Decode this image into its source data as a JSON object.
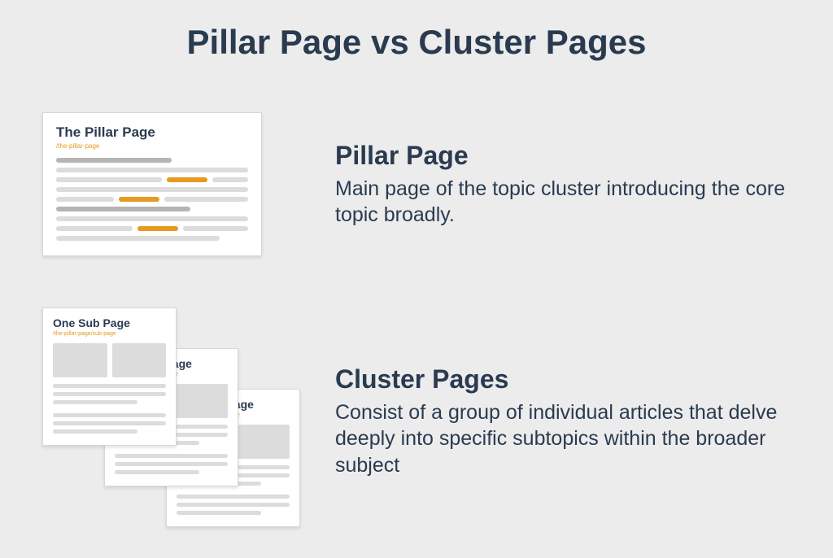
{
  "title": "Pillar Page vs Cluster Pages",
  "pillar": {
    "heading": "Pillar Page",
    "body": "Main page of the topic cluster introducing the core topic broadly.",
    "card_title": "The Pillar Page",
    "card_url": "/the-pillar-page"
  },
  "cluster": {
    "heading": "Cluster Pages",
    "body": "Consist of a group of individual articles that delve deeply into specific subtopics within the broader subject",
    "cards": [
      {
        "title": "One Sub Page",
        "url": "/the-pillar-page/sub-page"
      },
      {
        "title": "One Sub Page",
        "url": "/the-pillar-page/sub-page"
      },
      {
        "title": "One Sub Page",
        "url": "/the-pillar-page/sub-page"
      }
    ]
  },
  "colors": {
    "bg": "#ececec",
    "text": "#2a3b50",
    "accent": "#e69a1f",
    "placeholder": "#dcdcdc",
    "placeholder_dark": "#b5b5b5"
  }
}
